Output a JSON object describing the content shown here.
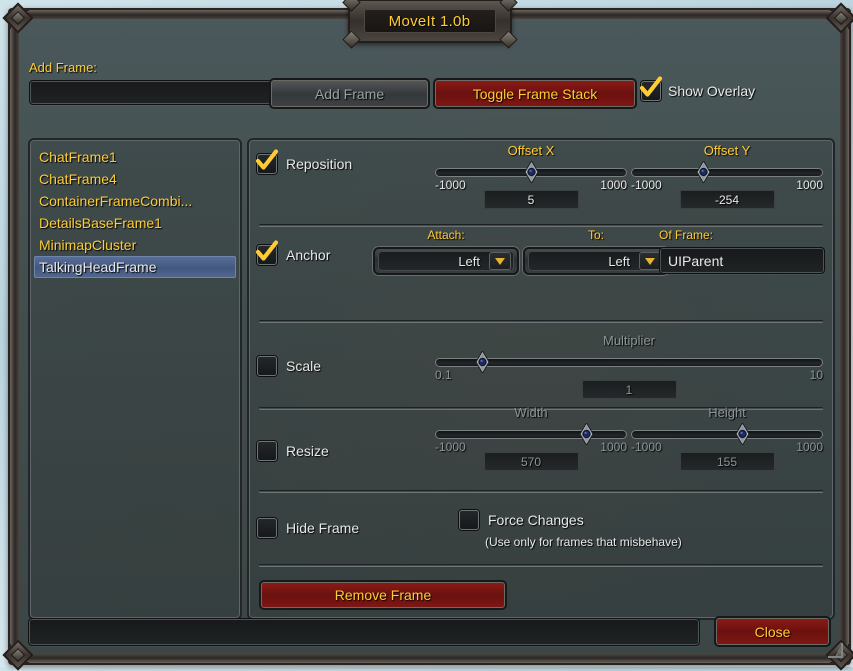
{
  "window": {
    "title": "MoveIt 1.0b"
  },
  "toolbar": {
    "add_frame_label": "Add Frame:",
    "add_frame_input_value": "",
    "add_frame_input_placeholder": "",
    "add_frame_button": "Add Frame",
    "toggle_frame_stack_button": "Toggle Frame Stack",
    "show_overlay_label": "Show Overlay",
    "show_overlay_checked": true
  },
  "frame_list": {
    "items": [
      {
        "label": "ChatFrame1",
        "selected": false
      },
      {
        "label": "ChatFrame4",
        "selected": false
      },
      {
        "label": "ContainerFrameCombi...",
        "selected": false
      },
      {
        "label": "DetailsBaseFrame1",
        "selected": false
      },
      {
        "label": "MinimapCluster",
        "selected": false
      },
      {
        "label": "TalkingHeadFrame",
        "selected": true
      }
    ]
  },
  "sections": {
    "reposition": {
      "label": "Reposition",
      "checked": true,
      "offset_x": {
        "title": "Offset X",
        "min": "-1000",
        "max": "1000",
        "value": "5",
        "pct": 50.2
      },
      "offset_y": {
        "title": "Offset Y",
        "min": "-1000",
        "max": "1000",
        "value": "-254",
        "pct": 37.3
      }
    },
    "anchor": {
      "label": "Anchor",
      "checked": true,
      "attach": {
        "title": "Attach:",
        "value": "Left"
      },
      "to": {
        "title": "To:",
        "value": "Left"
      },
      "of_frame": {
        "title": "Of Frame:",
        "value": "UIParent"
      }
    },
    "scale": {
      "label": "Scale",
      "checked": false,
      "multiplier": {
        "title": "Multiplier",
        "min": "0.1",
        "max": "10",
        "value": "1",
        "pct": 12.2
      }
    },
    "resize": {
      "label": "Resize",
      "checked": false,
      "width": {
        "title": "Width",
        "min": "-1000",
        "max": "1000",
        "value": "570",
        "pct": 78.5
      },
      "height": {
        "title": "Height",
        "min": "-1000",
        "max": "1000",
        "value": "155",
        "pct": 57.8
      }
    },
    "hide_frame": {
      "label": "Hide Frame",
      "checked": false
    },
    "force_changes": {
      "label": "Force Changes",
      "hint": "(Use only for frames that misbehave)",
      "checked": false
    },
    "remove_frame_button": "Remove Frame"
  },
  "footer": {
    "status_input_value": "",
    "close_button": "Close"
  },
  "colors": {
    "gold": "#ffcc33",
    "red_button": "#8e1b17",
    "selection_blue": "#4a6390",
    "panel_bg": "#3f4b4b"
  }
}
